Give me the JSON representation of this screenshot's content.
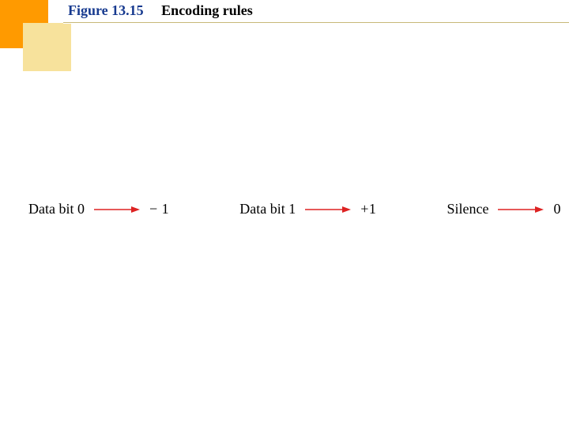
{
  "header": {
    "figure_label": "Figure 13.15",
    "figure_title": "Encoding rules"
  },
  "rules": [
    {
      "label": "Data bit 0",
      "value": "− 1"
    },
    {
      "label": "Data bit 1",
      "value": "+1"
    },
    {
      "label": "Silence",
      "value": "0"
    }
  ],
  "colors": {
    "arrow": "#d22",
    "figure_label": "#173a8f"
  }
}
